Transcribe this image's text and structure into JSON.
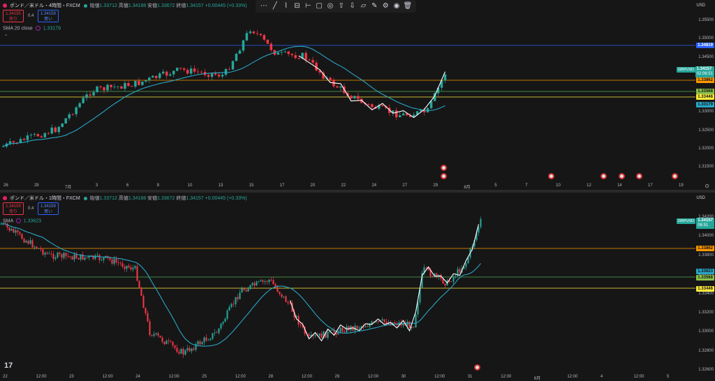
{
  "toolbar": {
    "icons": [
      "horizontal-line-icon",
      "trend-line-icon",
      "path-icon",
      "rectangle-icon",
      "horizontal-ray-icon",
      "rectangle-alt-icon",
      "circle-icon",
      "arrow-up-icon",
      "arrow-down-icon",
      "callout-icon",
      "brush-icon",
      "settings-icon",
      "visibility-icon",
      "trash-icon"
    ]
  },
  "colors": {
    "up": "#26a69a",
    "down": "#f23645",
    "sma": "#29a7c7",
    "zigzag": "#ffffff",
    "orange": "#ff9800",
    "green_line": "#4caf50",
    "yellow_line": "#ffeb3b",
    "blue_line": "#2962ff"
  },
  "top": {
    "title": "ポンド／米ドル・4時間・FXCM",
    "o_label": "始値",
    "o": "1.33712",
    "h_label": "高値",
    "h": "1.34188",
    "l_label": "安値",
    "l": "1.33672",
    "c_label": "終値",
    "c": "1.34157",
    "chg": "+0.00445 (+0.33%)",
    "sell_price": "1.34155",
    "sell_label": "売り",
    "spread": "0.4",
    "buy_price": "1.34159",
    "buy_label": "買い",
    "sma_label": "SMA 20 close",
    "sma_value": "1.33179",
    "currency": "USD",
    "symbol": "GBPUSD",
    "price_current": "1.34157",
    "countdown": "02:06:51",
    "price_axis": [
      "1.35500",
      "1.35000",
      "1.34500",
      "1.34000",
      "1.33500",
      "1.33000",
      "1.32500",
      "1.32000",
      "1.31500"
    ],
    "tags": {
      "blue": "1.34819",
      "orange": "1.33862",
      "green": "1.33568",
      "yellow": "1.33446",
      "sma": "1.33179"
    },
    "dates": [
      "26",
      "29",
      "7月",
      "3",
      "6",
      "8",
      "10",
      "13",
      "15",
      "17",
      "20",
      "22",
      "24",
      "27",
      "29",
      "8月",
      "5",
      "7",
      "10",
      "12",
      "14",
      "17",
      "19"
    ]
  },
  "bottom": {
    "title": "ポンド／米ドル・1時間・FXCM",
    "o_label": "始値",
    "o": "1.33712",
    "h_label": "高値",
    "h": "1.34188",
    "l_label": "安値",
    "l": "1.33672",
    "c_label": "終値",
    "c": "1.34157",
    "chg": "+0.00445 (+0.33%)",
    "sell_price": "1.34159",
    "sell_label": "売り",
    "spread": "0.4",
    "buy_price": "1.34159",
    "buy_label": "買い",
    "sma_label": "SMA",
    "sma_value": "1.33623",
    "currency": "USD",
    "symbol": "GBPUSD",
    "price_current": "1.34157",
    "countdown": "06:51",
    "price_axis": [
      "1.34200",
      "1.34000",
      "1.33800",
      "1.33600",
      "1.33400",
      "1.33200",
      "1.33000",
      "1.32800",
      "1.32600"
    ],
    "tags": {
      "orange": "1.33862",
      "cyan": "1.33623",
      "green": "1.33568",
      "yellow": "1.33446"
    },
    "dates": [
      "22",
      "12:00",
      "23",
      "12:00",
      "24",
      "12:00",
      "25",
      "12:00",
      "28",
      "12:00",
      "29",
      "12:00",
      "30",
      "12:00",
      "31",
      "12:00",
      "8月",
      "12:00",
      "4",
      "12:00",
      "5"
    ]
  }
}
